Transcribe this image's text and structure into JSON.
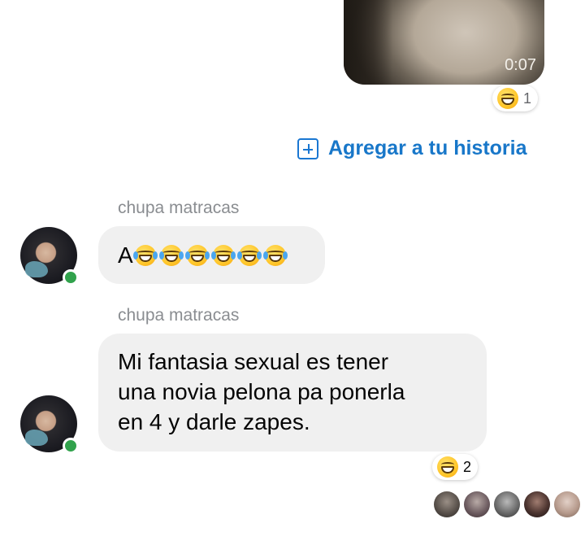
{
  "video": {
    "duration": "0:07"
  },
  "video_reaction": {
    "emoji": "grinning-squinting-face",
    "count": "1"
  },
  "add_story": {
    "label": "Agregar a tu historia",
    "icon": "plus-square-icon",
    "color": "#1877c9"
  },
  "messages": [
    {
      "sender": "chupa matracas",
      "text_prefix": "A",
      "emoji": "face-with-tears-of-joy",
      "emoji_count": 6
    },
    {
      "sender": "chupa matracas",
      "lines": [
        "Mi fantasia sexual es tener",
        "una novia pelona pa ponerla",
        "en 4 y darle zapes."
      ],
      "reaction": {
        "emoji": "grinning-squinting-face",
        "count": "2"
      }
    }
  ],
  "seen_by_count": 5,
  "colors": {
    "bubble": "#f0f0f0",
    "online": "#31a24c",
    "name": "#8a8d91"
  }
}
